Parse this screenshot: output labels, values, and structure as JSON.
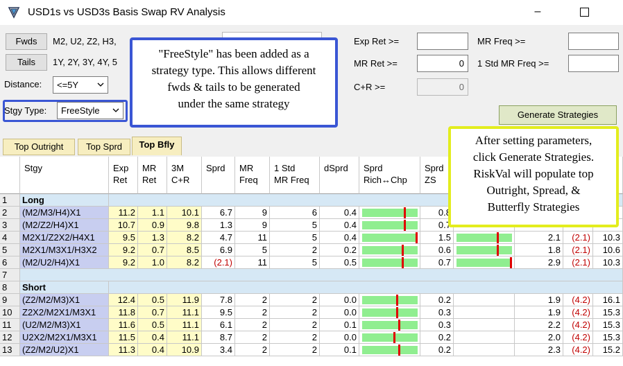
{
  "window": {
    "title": "USD1s vs USD3s Basis Swap RV Analysis",
    "minimize": "–"
  },
  "panel": {
    "fwds_button": "Fwds",
    "fwds_value": "M2, U2, Z2, H3, ",
    "tails_button": "Tails",
    "tails_value": "1Y, 2Y, 3Y, 4Y, 5",
    "distance_label": "Distance:",
    "distance_value": "<=5Y",
    "stgy_type_label": "Stgy Type:",
    "stgy_type_value": "FreeStyle",
    "exp_ret_label": "Exp Ret >=",
    "exp_ret_value": "",
    "mr_ret_label": "MR Ret >=",
    "mr_ret_value": "0",
    "cr_label": "C+R >=",
    "cr_value": "0",
    "mr_freq_label": "MR Freq >=",
    "mr_freq_value": "",
    "std_mr_freq_label": "1 Std MR Freq >=",
    "std_mr_freq_value": "",
    "generate_button": "Generate Strategies"
  },
  "tabs": [
    {
      "label": "Top Outright",
      "active": false
    },
    {
      "label": "Top Sprd",
      "active": false
    },
    {
      "label": "Top Bfly",
      "active": true
    }
  ],
  "columns": {
    "stgy": "Stgy",
    "exp_ret": [
      "Exp",
      "Ret"
    ],
    "mr_ret": [
      "MR",
      "Ret"
    ],
    "cr": [
      "3M",
      "C+R"
    ],
    "sprd": "Sprd",
    "mr_freq": [
      "MR",
      "Freq"
    ],
    "std_mr_freq": [
      "1 Std",
      "MR Freq"
    ],
    "dsprd": "dSprd",
    "rich_chp": [
      "Sprd",
      "Rich↔Chp"
    ],
    "sprd_zs": [
      "Sprd",
      "ZS"
    ]
  },
  "sections": {
    "long": "Long",
    "short": "Short"
  },
  "rows": [
    {
      "n": "1",
      "type": "section",
      "label": "Long"
    },
    {
      "n": "2",
      "stgy": "(M2/M3/H4)X1",
      "exp": "11.2",
      "mr": "1.1",
      "cr": "10.1",
      "sprd": "6.7",
      "mrf": "9",
      "std": "6",
      "ds": "0.4",
      "rich": 0.76,
      "zs": "0.8",
      "rich2": null,
      "x": "",
      "neg": "",
      "last": ""
    },
    {
      "n": "3",
      "stgy": "(M2/Z2/H4)X1",
      "exp": "10.7",
      "mr": "0.9",
      "cr": "9.8",
      "sprd": "1.3",
      "mrf": "9",
      "std": "5",
      "ds": "0.4",
      "rich": 0.76,
      "zs": "0.7",
      "rich2": null,
      "x": "",
      "neg": "",
      "last": ""
    },
    {
      "n": "4",
      "stgy": "M2X1/Z2X2/H4X1",
      "exp": "9.5",
      "mr": "1.3",
      "cr": "8.2",
      "sprd": "4.7",
      "mrf": "11",
      "std": "5",
      "ds": "0.4",
      "rich": 0.97,
      "zs": "1.5",
      "rich2": 0.74,
      "x": "2.1",
      "neg": "(2.1)",
      "last": "10.3"
    },
    {
      "n": "5",
      "stgy": "M2X1/M3X1/H3X2",
      "exp": "9.2",
      "mr": "0.7",
      "cr": "8.5",
      "sprd": "6.9",
      "mrf": "5",
      "std": "2",
      "ds": "0.2",
      "rich": 0.72,
      "zs": "0.6",
      "rich2": 0.74,
      "x": "1.8",
      "neg": "(2.1)",
      "last": "10.6"
    },
    {
      "n": "6",
      "stgy": "(M2/U2/H4)X1",
      "exp": "9.2",
      "mr": "1.0",
      "cr": "8.2",
      "sprd": "(2.1)",
      "mrf": "11",
      "std": "5",
      "ds": "0.5",
      "rich": 0.72,
      "zs": "0.7",
      "rich2": 0.97,
      "x": "2.9",
      "neg": "(2.1)",
      "last": "10.3"
    },
    {
      "n": "7",
      "type": "blank"
    },
    {
      "n": "8",
      "type": "section",
      "label": "Short"
    },
    {
      "n": "9",
      "stgy": "(Z2/M2/M3)X1",
      "exp": "12.4",
      "mr": "0.5",
      "cr": "11.9",
      "sprd": "7.8",
      "mrf": "2",
      "std": "2",
      "ds": "0.0",
      "rich": 0.62,
      "zs": "0.2",
      "rich2": null,
      "x": "1.9",
      "neg": "(4.2)",
      "last": "16.1"
    },
    {
      "n": "10",
      "stgy": "Z2X2/M2X1/M3X1",
      "exp": "11.8",
      "mr": "0.7",
      "cr": "11.1",
      "sprd": "9.5",
      "mrf": "2",
      "std": "2",
      "ds": "0.0",
      "rich": 0.62,
      "zs": "0.3",
      "rich2": null,
      "x": "1.9",
      "neg": "(4.2)",
      "last": "15.3"
    },
    {
      "n": "11",
      "stgy": "(U2/M2/M3)X1",
      "exp": "11.6",
      "mr": "0.5",
      "cr": "11.1",
      "sprd": "6.1",
      "mrf": "2",
      "std": "2",
      "ds": "0.1",
      "rich": 0.66,
      "zs": "0.3",
      "rich2": null,
      "x": "2.2",
      "neg": "(4.2)",
      "last": "15.3"
    },
    {
      "n": "12",
      "stgy": "U2X2/M2X1/M3X1",
      "exp": "11.5",
      "mr": "0.4",
      "cr": "11.1",
      "sprd": "8.7",
      "mrf": "2",
      "std": "2",
      "ds": "0.0",
      "rich": 0.58,
      "zs": "0.2",
      "rich2": null,
      "x": "2.0",
      "neg": "(4.2)",
      "last": "15.3"
    },
    {
      "n": "13",
      "stgy": "(Z2/M2/U2)X1",
      "exp": "11.3",
      "mr": "0.4",
      "cr": "10.9",
      "sprd": "3.4",
      "mrf": "2",
      "std": "2",
      "ds": "0.1",
      "rich": 0.66,
      "zs": "0.2",
      "rich2": null,
      "x": "2.3",
      "neg": "(4.2)",
      "last": "15.2"
    }
  ],
  "callouts": {
    "freestyle": [
      "\"FreeStyle\" has been added as a",
      "strategy type. This allows different",
      "fwds & tails to be generated",
      "under the same strategy"
    ],
    "generate": [
      "After setting parameters,",
      "click Generate Strategies.",
      "RiskVal will populate top",
      "Outright, Spread, &",
      "Butterfly Strategies"
    ]
  },
  "colors": {
    "stgy_cell": "#c8cef0",
    "return_cell": "#fffcc8",
    "section_row": "#d6e8f5",
    "bar": "#90ee90",
    "marker": "#e00000",
    "callout_blue": "#3a56d4",
    "callout_yellow": "#e3ed1e"
  }
}
